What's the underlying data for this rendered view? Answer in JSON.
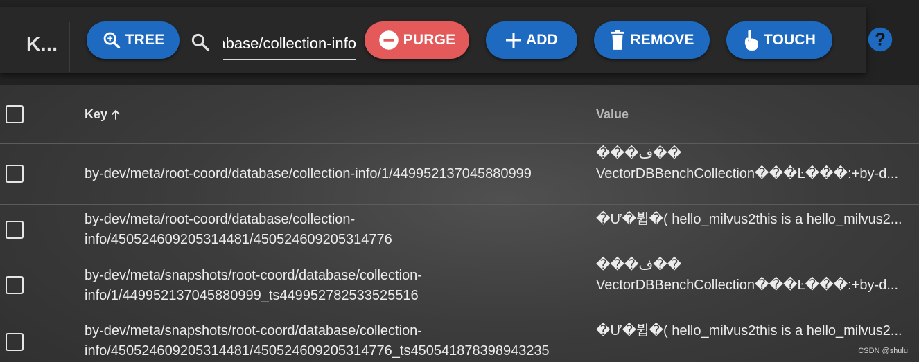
{
  "toolbar": {
    "brand": "K...",
    "tree_label": "TREE",
    "search_value": "by-dev/meta/root-coord/database/collection-info",
    "purge_label": "PURGE",
    "add_label": "ADD",
    "remove_label": "REMOVE",
    "touch_label": "TOUCH",
    "help_label": "?"
  },
  "table": {
    "columns": {
      "key": "Key",
      "value": "Value"
    },
    "sort_icon": "arrow-up-icon",
    "rows": [
      {
        "key": "by-dev/meta/root-coord/database/collection-info/1/449952137045880999",
        "value": "���ف��\nVectorDBBenchCollection���Ŀ���:+by-d..."
      },
      {
        "key": "by-dev/meta/root-coord/database/collection-info/450524609205314481/450524609205314776",
        "value": "�Ư�뷥�( hello_milvus2this is a hello_milvus2..."
      },
      {
        "key": "by-dev/meta/snapshots/root-coord/database/collection-info/1/449952137045880999_ts449952782533525516",
        "value": "���ف��\nVectorDBBenchCollection���Ŀ���:+by-d..."
      },
      {
        "key": "by-dev/meta/snapshots/root-coord/database/collection-info/450524609205314481/450524609205314776_ts450541878398943235",
        "value": "�Ư�뷥�( hello_milvus2this is a hello_milvus2..."
      }
    ]
  },
  "watermark": "CSDN @shulu",
  "colors": {
    "primary_blue": "#1d6ac0",
    "danger_red": "#e45a5a",
    "toolbar_bg": "#282828"
  }
}
